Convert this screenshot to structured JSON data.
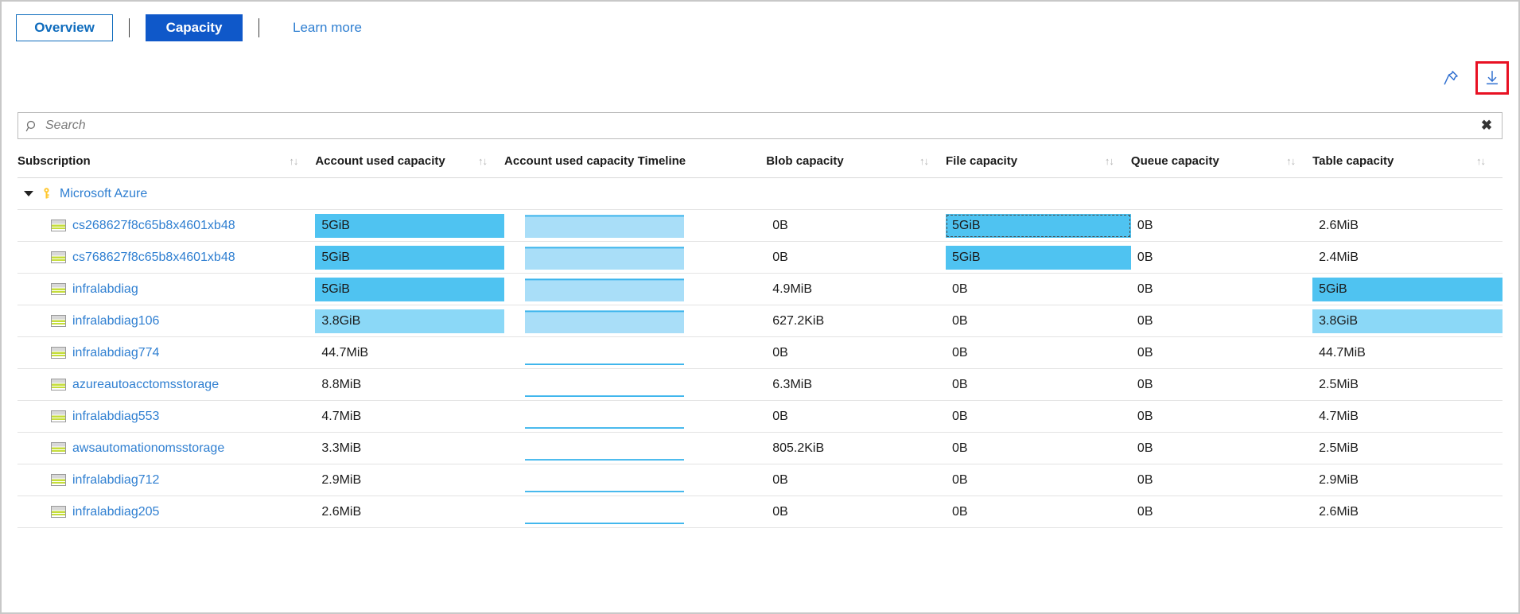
{
  "tabs": {
    "overview_label": "Overview",
    "capacity_label": "Capacity",
    "learn_more_label": "Learn more"
  },
  "actions": {
    "pin_icon": "pin-icon",
    "download_icon": "download-icon"
  },
  "search": {
    "placeholder": "Search",
    "value": "",
    "clear_label": "✖",
    "search_icon": "search-icon"
  },
  "colors": {
    "accent_blue": "#0f58c9",
    "link_blue": "#2f7fd1",
    "bar_strong": "#4fc3f1",
    "bar_light": "#8bd8f7",
    "spark_fill": "#a9def8",
    "spark_line": "#3bb4ec",
    "highlight_red": "#e81123",
    "key_yellow": "#ffc72c"
  },
  "table": {
    "columns": [
      {
        "label": "Subscription",
        "sortable": true
      },
      {
        "label": "Account used capacity",
        "sortable": true
      },
      {
        "label": "Account used capacity Timeline",
        "sortable": false
      },
      {
        "label": "Blob capacity",
        "sortable": true
      },
      {
        "label": "File capacity",
        "sortable": true
      },
      {
        "label": "Queue capacity",
        "sortable": true
      },
      {
        "label": "Table capacity",
        "sortable": true
      }
    ],
    "group": {
      "label": "Microsoft Azure",
      "expanded": true,
      "icon": "key-icon"
    },
    "rows": [
      {
        "name": "cs268627f8c65b8x4601xb48",
        "account_used": "5GiB",
        "account_used_bar": 100,
        "account_used_shade": "strong",
        "timeline_fill": 92,
        "blob": "0B",
        "blob_bar": 0,
        "file": "5GiB",
        "file_bar": 100,
        "file_shade": "strong",
        "file_focused": true,
        "queue": "0B",
        "queue_bar": 0,
        "table": "2.6MiB",
        "table_bar": 0
      },
      {
        "name": "cs768627f8c65b8x4601xb48",
        "account_used": "5GiB",
        "account_used_bar": 100,
        "account_used_shade": "strong",
        "timeline_fill": 92,
        "blob": "0B",
        "blob_bar": 0,
        "file": "5GiB",
        "file_bar": 100,
        "file_shade": "strong",
        "file_focused": false,
        "queue": "0B",
        "queue_bar": 0,
        "table": "2.4MiB",
        "table_bar": 0
      },
      {
        "name": "infralabdiag",
        "account_used": "5GiB",
        "account_used_bar": 100,
        "account_used_shade": "strong",
        "timeline_fill": 92,
        "blob": "4.9MiB",
        "blob_bar": 0,
        "file": "0B",
        "file_bar": 0,
        "file_shade": "strong",
        "file_focused": false,
        "queue": "0B",
        "queue_bar": 0,
        "table": "5GiB",
        "table_bar": 100,
        "table_shade": "strong"
      },
      {
        "name": "infralabdiag106",
        "account_used": "3.8GiB",
        "account_used_bar": 100,
        "account_used_shade": "light",
        "timeline_fill": 92,
        "blob": "627.2KiB",
        "blob_bar": 0,
        "file": "0B",
        "file_bar": 0,
        "file_shade": "strong",
        "file_focused": false,
        "queue": "0B",
        "queue_bar": 0,
        "table": "3.8GiB",
        "table_bar": 100,
        "table_shade": "light"
      },
      {
        "name": "infralabdiag774",
        "account_used": "44.7MiB",
        "account_used_bar": 0,
        "timeline_fill": 3,
        "blob": "0B",
        "blob_bar": 0,
        "file": "0B",
        "file_bar": 0,
        "queue": "0B",
        "queue_bar": 0,
        "table": "44.7MiB",
        "table_bar": 0
      },
      {
        "name": "azureautoacctomsstorage",
        "account_used": "8.8MiB",
        "account_used_bar": 0,
        "timeline_fill": 3,
        "blob": "6.3MiB",
        "blob_bar": 0,
        "file": "0B",
        "file_bar": 0,
        "queue": "0B",
        "queue_bar": 0,
        "table": "2.5MiB",
        "table_bar": 0
      },
      {
        "name": "infralabdiag553",
        "account_used": "4.7MiB",
        "account_used_bar": 0,
        "timeline_fill": 3,
        "blob": "0B",
        "blob_bar": 0,
        "file": "0B",
        "file_bar": 0,
        "queue": "0B",
        "queue_bar": 0,
        "table": "4.7MiB",
        "table_bar": 0
      },
      {
        "name": "awsautomationomsstorage",
        "account_used": "3.3MiB",
        "account_used_bar": 0,
        "timeline_fill": 3,
        "blob": "805.2KiB",
        "blob_bar": 0,
        "file": "0B",
        "file_bar": 0,
        "queue": "0B",
        "queue_bar": 0,
        "table": "2.5MiB",
        "table_bar": 0
      },
      {
        "name": "infralabdiag712",
        "account_used": "2.9MiB",
        "account_used_bar": 0,
        "timeline_fill": 3,
        "blob": "0B",
        "blob_bar": 0,
        "file": "0B",
        "file_bar": 0,
        "queue": "0B",
        "queue_bar": 0,
        "table": "2.9MiB",
        "table_bar": 0
      },
      {
        "name": "infralabdiag205",
        "account_used": "2.6MiB",
        "account_used_bar": 0,
        "timeline_fill": 3,
        "blob": "0B",
        "blob_bar": 0,
        "file": "0B",
        "file_bar": 0,
        "queue": "0B",
        "queue_bar": 0,
        "table": "2.6MiB",
        "table_bar": 0
      }
    ]
  }
}
